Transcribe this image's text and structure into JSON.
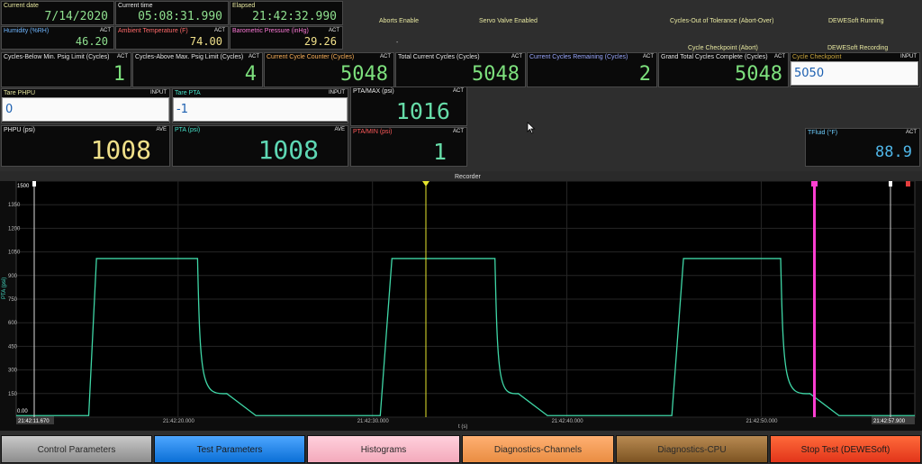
{
  "top": {
    "current_date": {
      "label": "Current date",
      "value": "7/14/2020"
    },
    "current_time": {
      "label": "Current time",
      "value": "05:08:31.990"
    },
    "elapsed": {
      "label": "Elapsed",
      "value": "21:42:32.990"
    },
    "humidity": {
      "label": "Humidity (%RH)",
      "tag": "ACT",
      "value": "46.20"
    },
    "ambient": {
      "label": "Ambient Temperature (F)",
      "tag": "ACT",
      "value": "74.00"
    },
    "baro": {
      "label": "Barometric Pressure (inHg)",
      "tag": "ACT",
      "value": "29.26"
    }
  },
  "status": {
    "aborts_enable": "Aborts Enable",
    "servo_valve": "Servo Valve Enabled",
    "cycles_out": "Cycles-Out of Tolerance (Abort-Over)",
    "dewesoft_running": "DEWESoft Running",
    "cycle_checkpoint_abort": "Cycle Checkpoint (Abort)",
    "dewesoft_recording": "DEWESoft Recording",
    "dash": "-"
  },
  "counters": [
    {
      "label": "Cycles-Below Min. Psig Limit (Cycles)",
      "tag": "ACT",
      "value": "1"
    },
    {
      "label": "Cycles-Above Max. Psig Limit (Cycles)",
      "tag": "ACT",
      "value": "4"
    },
    {
      "label": "Current Cycle Counter (Cycles)",
      "tag": "ACT",
      "value": "5048"
    },
    {
      "label": "Total Current Cycles (Cycles)",
      "tag": "ACT",
      "value": "5048"
    },
    {
      "label": "Current Cycles Remaining (Cycles)",
      "tag": "ACT",
      "value": "2"
    },
    {
      "label": "Grand Total Cycles Complete (Cycles)",
      "tag": "ACT",
      "value": "5048"
    }
  ],
  "cycle_checkpoint": {
    "label": "Cycle Checkpoint",
    "tag": "INPUT",
    "value": "5050"
  },
  "tare_phpu": {
    "label": "Tare PHPU",
    "tag": "INPUT",
    "value": "0"
  },
  "tare_pta": {
    "label": "Tare PTA",
    "tag": "INPUT",
    "value": "-1"
  },
  "pta_max": {
    "label": "PTA/MAX (psi)",
    "tag": "ACT",
    "value": "1016"
  },
  "pta_min": {
    "label": "PTA/MIN (psi)",
    "tag": "ACT",
    "value": "1"
  },
  "phpu": {
    "label": "PHPU (psi)",
    "tag": "AVE",
    "value": "1008"
  },
  "pta": {
    "label": "PTA (psi)",
    "tag": "AVE",
    "value": "1008"
  },
  "tfluid": {
    "label": "TFluid (°F)",
    "tag": "ACT",
    "value": "88.9"
  },
  "recorder": {
    "title": "Recorder",
    "ylabel": "PTA (psi)",
    "xlabel": "t (s)",
    "yticks": [
      "0",
      "150",
      "300",
      "450",
      "600",
      "750",
      "900",
      "1050",
      "1200",
      "1350",
      "1500"
    ],
    "xticks": [
      "21:42:20.000",
      "21:42:30.000",
      "21:42:40.000",
      "21:42:50.000"
    ],
    "start_time": "21:42:11.670",
    "end_time": "21:42:57.900",
    "y_range_label": "1500",
    "y_min_label": "0.00",
    "colors": {
      "trace": "#3fd6a6",
      "cursor": "#e6e62e",
      "marker": "#ff3fd2",
      "end": "#e43d3d"
    }
  },
  "chart_data": {
    "type": "line",
    "xlabel": "t (s)",
    "ylabel": "PTA (psi)",
    "ylim": [
      0,
      1500
    ],
    "x": [
      "21:42:11.670",
      "21:42:15.4",
      "21:42:15.8",
      "21:42:21.0",
      "21:42:22.5",
      "21:42:24.0",
      "21:42:30.4",
      "21:42:31.0",
      "21:42:36.3",
      "21:42:37.5",
      "21:42:39.0",
      "21:42:45.4",
      "21:42:46.0",
      "21:42:51.0",
      "21:42:52.5",
      "21:42:54.0",
      "21:42:57.900"
    ],
    "series": [
      {
        "values": [
          10,
          10,
          1008,
          1008,
          150,
          10,
          10,
          1008,
          1008,
          150,
          10,
          10,
          1008,
          1008,
          150,
          10,
          10
        ]
      }
    ]
  },
  "buttons": [
    {
      "label": "Control Parameters"
    },
    {
      "label": "Test Parameters"
    },
    {
      "label": "Histograms"
    },
    {
      "label": "Diagnostics-Channels"
    },
    {
      "label": "Diagnostics-CPU"
    },
    {
      "label": "Stop Test (DEWESoft)"
    }
  ]
}
